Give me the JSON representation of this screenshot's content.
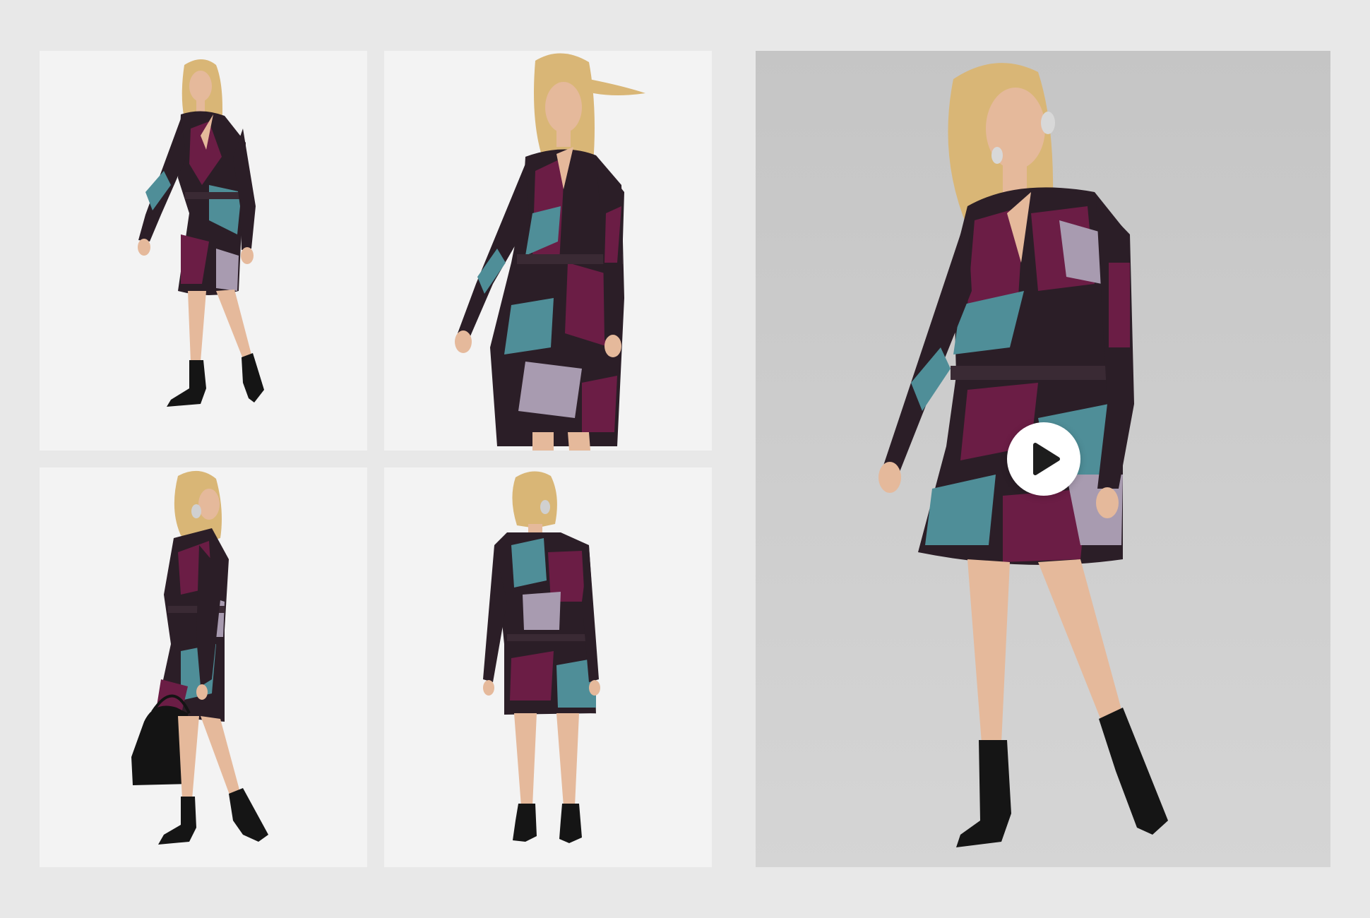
{
  "gallery": {
    "thumbnails": [
      {
        "view": "front-full"
      },
      {
        "view": "front-closeup"
      },
      {
        "view": "side-with-bag"
      },
      {
        "view": "back"
      }
    ],
    "hero": {
      "view": "front-video",
      "icon": "play-icon"
    }
  },
  "colors": {
    "page_bg": "#e8e8e8",
    "thumb_bg": "#f3f3f3",
    "hero_bg": "#c9c9c9",
    "dress_dark": "#2b1e27",
    "dress_plum": "#6b1d45",
    "dress_teal": "#4f8e98",
    "dress_lilac": "#a89bb0",
    "hair": "#d9b676",
    "skin": "#e5b99b",
    "boots": "#151515"
  }
}
